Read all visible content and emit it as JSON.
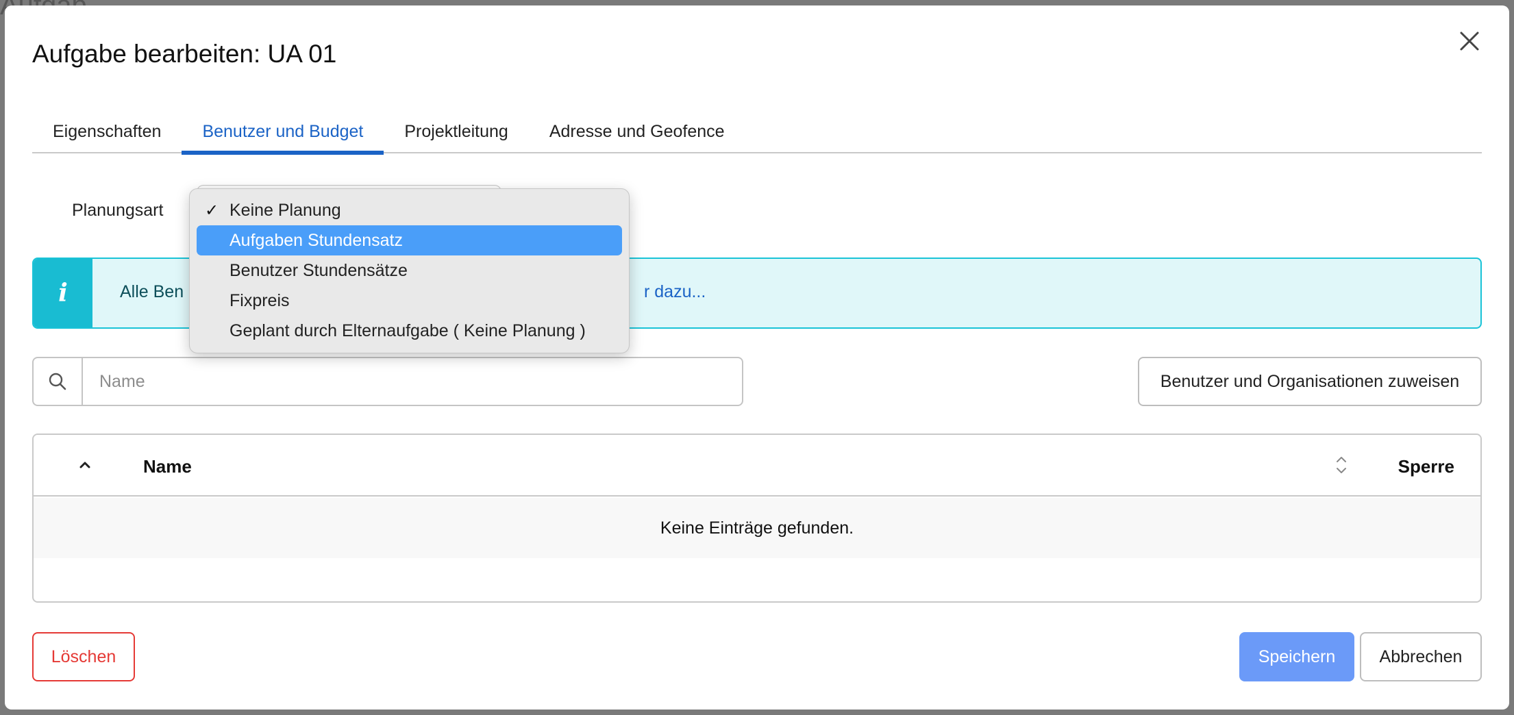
{
  "backdrop": {
    "title_fragment": "Aufgab"
  },
  "modal": {
    "title": "Aufgabe bearbeiten: UA 01",
    "tabs": [
      {
        "label": "Eigenschaften",
        "active": false
      },
      {
        "label": "Benutzer und Budget",
        "active": true
      },
      {
        "label": "Projektleitung",
        "active": false
      },
      {
        "label": "Adresse und Geofence",
        "active": false
      }
    ],
    "planning": {
      "label": "Planungsart",
      "options": [
        {
          "label": "Keine Planung",
          "checked": true,
          "highlighted": false
        },
        {
          "label": "Aufgaben Stundensatz",
          "checked": false,
          "highlighted": true
        },
        {
          "label": "Benutzer Stundensätze",
          "checked": false,
          "highlighted": false
        },
        {
          "label": "Fixpreis",
          "checked": false,
          "highlighted": false
        },
        {
          "label": "Geplant durch Elternaufgabe ( Keine Planung )",
          "checked": false,
          "highlighted": false
        }
      ]
    },
    "info": {
      "text": "Alle Ben",
      "link_text": "r dazu..."
    },
    "search": {
      "placeholder": "Name",
      "value": ""
    },
    "assign_button": "Benutzer und Organisationen zuweisen",
    "table": {
      "columns": [
        "Name",
        "Sperre"
      ],
      "empty_message": "Keine Einträge gefunden."
    },
    "buttons": {
      "delete": "Löschen",
      "save": "Speichern",
      "cancel": "Abbrechen"
    }
  },
  "colors": {
    "accent": "#1b63c6",
    "info_border": "#19c3d7",
    "info_bg": "#e0f7f9",
    "danger": "#e53935",
    "primary_button": "#6b9af8",
    "highlight": "#4a9ef9"
  },
  "icons": {
    "close": "close-icon",
    "search": "search-icon",
    "info": "info-icon",
    "sort_up": "chevron-up-icon",
    "sort_both": "sort-icon",
    "check": "checkmark-icon"
  }
}
